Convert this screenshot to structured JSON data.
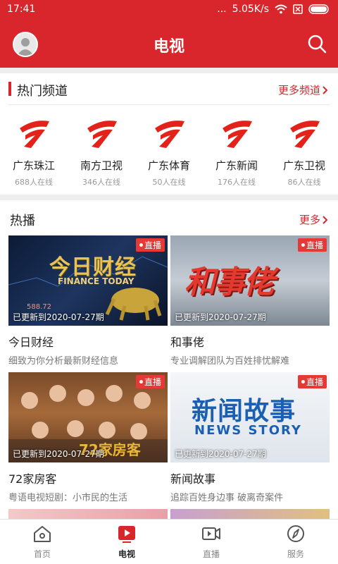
{
  "status": {
    "time": "17:41",
    "speed": "5.05K/s",
    "dots": "..."
  },
  "header": {
    "title": "电视"
  },
  "hot_channels": {
    "title": "热门频道",
    "more": "更多频道",
    "items": [
      {
        "name": "广东珠江",
        "count": "688人在线"
      },
      {
        "name": "南方卫视",
        "count": "346人在线"
      },
      {
        "name": "广东体育",
        "count": "50人在线"
      },
      {
        "name": "广东新闻",
        "count": "176人在线"
      },
      {
        "name": "广东卫视",
        "count": "86人在线"
      }
    ]
  },
  "hot_play": {
    "title": "热播",
    "more": "更多",
    "live_label": "直播",
    "cards": [
      {
        "title": "今日财经",
        "desc": "细致为你分析最新财经信息",
        "updated": "已更新到2020-07-27期",
        "thumb_text": "今日财经",
        "thumb_sub": "FINANCE TODAY",
        "thumb_num": "588.72"
      },
      {
        "title": "和事佬",
        "desc": "专业调解团队为百姓排忧解难",
        "updated": "已更新到2020-07-27期",
        "thumb_text": "和事佬"
      },
      {
        "title": "72家房客",
        "desc": "粤语电视短剧：小市民的生活",
        "updated": "已更新到2020-07-27期",
        "thumb_text": "72家房客"
      },
      {
        "title": "新闻故事",
        "desc": "追踪百姓身边事 破离奇案件",
        "updated": "已更新到2020-07-27期",
        "thumb_text": "新闻故事",
        "thumb_sub": "NEWS STORY"
      }
    ]
  },
  "nav": [
    {
      "label": "首页"
    },
    {
      "label": "电视"
    },
    {
      "label": "直播"
    },
    {
      "label": "服务"
    }
  ],
  "colors": {
    "brand": "#d8262c",
    "live": "#e53935"
  }
}
